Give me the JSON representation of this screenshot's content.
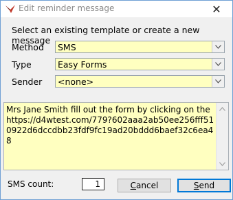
{
  "window": {
    "title": "Edit reminder message",
    "close_glyph": "✕"
  },
  "instruction": "Select an existing template or create a new message",
  "fields": {
    "method": {
      "label": "Method",
      "value": "SMS"
    },
    "type": {
      "label": "Type",
      "value": "Easy Forms"
    },
    "sender": {
      "label": "Sender",
      "value": "<none>"
    }
  },
  "message": {
    "text": "Mrs Jane Smith fill out the form by clicking on the https://d4wtest.com/779?602aaa2ab50ee256fff510922d6dccdbb23fdf9fc19ad20bddd6baef32c6ea48"
  },
  "sms": {
    "label": "SMS count:",
    "count": "1"
  },
  "buttons": {
    "cancel": {
      "first": "C",
      "rest": "ancel"
    },
    "send": {
      "first": "S",
      "rest": "end"
    }
  },
  "colors": {
    "field_bg": "#ffffc0",
    "window_bg": "#f0f0f0",
    "accent_border": "#0078d7",
    "app_icon": "#c0392b"
  },
  "icons": {
    "app": "app-logo-icon",
    "close": "close-icon",
    "dropdown": "chevron-down-icon",
    "scroll_up": "chevron-up-icon",
    "scroll_down": "chevron-down-icon"
  }
}
